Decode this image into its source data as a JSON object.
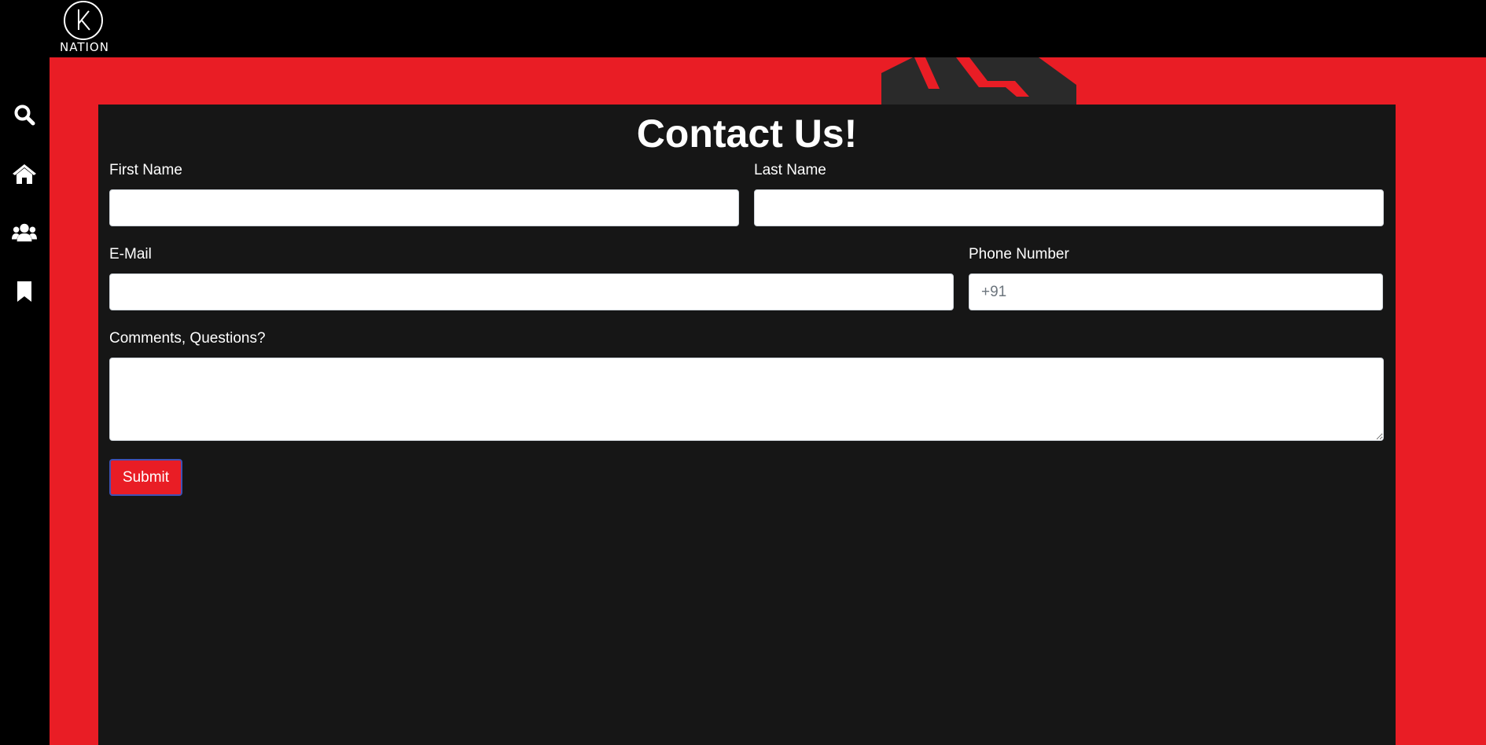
{
  "brand": {
    "logo_text": "NATION"
  },
  "sidebar": {
    "items": [
      {
        "name": "search",
        "icon": "search-icon"
      },
      {
        "name": "home",
        "icon": "home-icon"
      },
      {
        "name": "community",
        "icon": "users-icon"
      },
      {
        "name": "bookmarks",
        "icon": "bookmark-icon"
      }
    ]
  },
  "colors": {
    "accent": "#e91d25",
    "panel": "#161616",
    "topbar": "#000000"
  },
  "form": {
    "title": "Contact Us!",
    "first_name_label": "First Name",
    "first_name_value": "",
    "last_name_label": "Last Name",
    "last_name_value": "",
    "email_label": "E-Mail",
    "email_value": "",
    "phone_label": "Phone Number",
    "phone_placeholder": "+91",
    "comments_label": "Comments, Questions?",
    "comments_value": "",
    "submit_label": "Submit"
  }
}
